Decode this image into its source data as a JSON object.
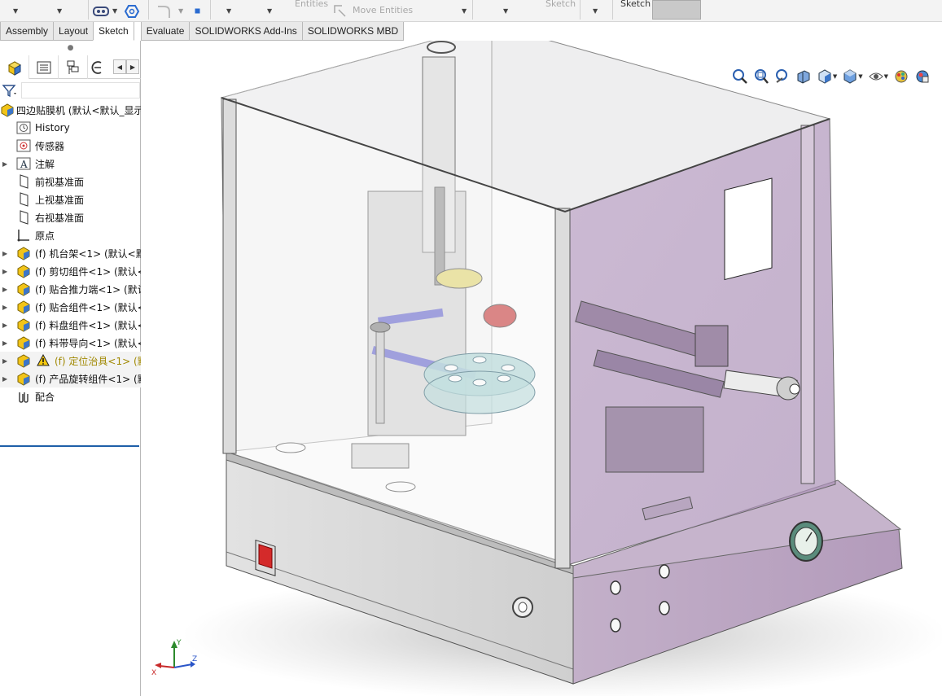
{
  "ribbon": {
    "ghost_top": "Entities",
    "move_entities": "Move Entities",
    "ghost_sketch": "Sketch",
    "sketch_block_label": "Sketch"
  },
  "tabs": [
    {
      "label": "Assembly",
      "active": false
    },
    {
      "label": "Layout",
      "active": false
    },
    {
      "label": "Sketch",
      "active": true
    },
    {
      "label": "Evaluate",
      "active": false
    },
    {
      "label": "SOLIDWORKS Add-Ins",
      "active": false
    },
    {
      "label": "SOLIDWORKS MBD",
      "active": false
    }
  ],
  "tree": {
    "root": "四边贴膜机 (默认<默认_显示",
    "history": "History",
    "sensors": "传感器",
    "annotations": "注解",
    "front_plane": "前视基准面",
    "top_plane": "上视基准面",
    "right_plane": "右视基准面",
    "origin": "原点",
    "components": [
      "(f) 机台架<1> (默认<默认",
      "(f) 剪切组件<1> (默认<",
      "(f) 贴合推力端<1> (默认",
      "(f) 贴合组件<1> (默认<",
      "(f) 料盘组件<1> (默认<",
      "(f) 料带导向<1> (默认<",
      "(f) 定位治具<1> (默",
      "(f) 产品旋转组件<1> (默"
    ],
    "mates": "配合"
  },
  "triad": {
    "x": "X",
    "y": "Y",
    "z": "Z"
  },
  "colors": {
    "enclosure_tint": "#b49ac0",
    "base_purple": "#b8a2bf",
    "base_gray": "#d4d4d4",
    "accent_blue": "#1f5fa8",
    "switch_red": "#d42a2a"
  }
}
